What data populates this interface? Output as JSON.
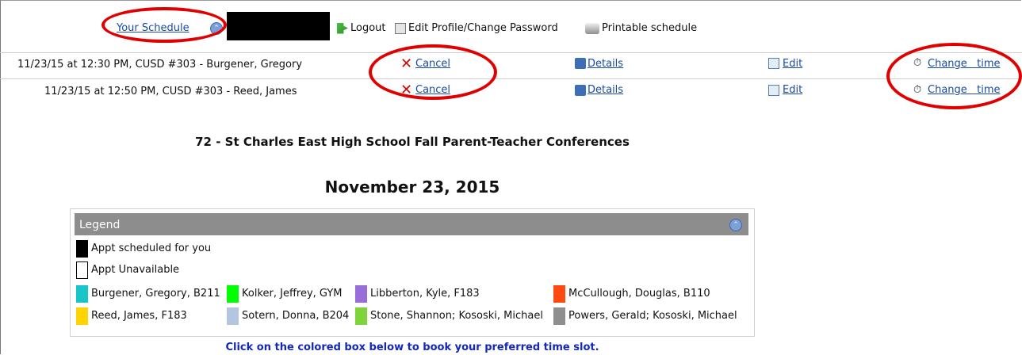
{
  "top": {
    "schedule_link": "Your Schedule",
    "logout": "Logout",
    "edit_profile": "Edit Profile/Change Password",
    "printable": "Printable schedule"
  },
  "appointments": [
    {
      "text": "11/23/15 at 12:30 PM, CUSD #303 - Burgener, Gregory",
      "cancel": "Cancel",
      "details": "Details",
      "edit": "Edit",
      "change_time": "Change   time"
    },
    {
      "text": "11/23/15 at 12:50 PM, CUSD #303 - Reed, James",
      "cancel": "Cancel",
      "details": "Details",
      "edit": "Edit",
      "change_time": "Change   time"
    }
  ],
  "page": {
    "title": "72 - St Charles East High School Fall Parent-Teacher Conferences",
    "date": "November 23, 2015"
  },
  "legend": {
    "title": "Legend",
    "items": [
      {
        "label": "Appt scheduled for you",
        "color": "#000000"
      },
      {
        "label": "Appt Unavailable",
        "color": "#ffffff"
      }
    ],
    "teachers": [
      {
        "label": "Burgener, Gregory, B211",
        "color": "#18c5c8"
      },
      {
        "label": "Kolker, Jeffrey, GYM",
        "color": "#00ff00"
      },
      {
        "label": "Libberton, Kyle, F183",
        "color": "#9a6ed8"
      },
      {
        "label": "McCullough, Douglas, B110",
        "color": "#ff4b12"
      },
      {
        "label": "Reed, James, F183",
        "color": "#ffd400"
      },
      {
        "label": "Sotern, Donna, B204",
        "color": "#b4c6df"
      },
      {
        "label": "Stone, Shannon; Kososki, Michael",
        "color": "#7fd33b"
      },
      {
        "label": "Powers, Gerald; Kososki, Michael",
        "color": "#8e8e8e"
      }
    ]
  },
  "footer": {
    "instruction": "Click on the colored box below to book your preferred time slot."
  }
}
